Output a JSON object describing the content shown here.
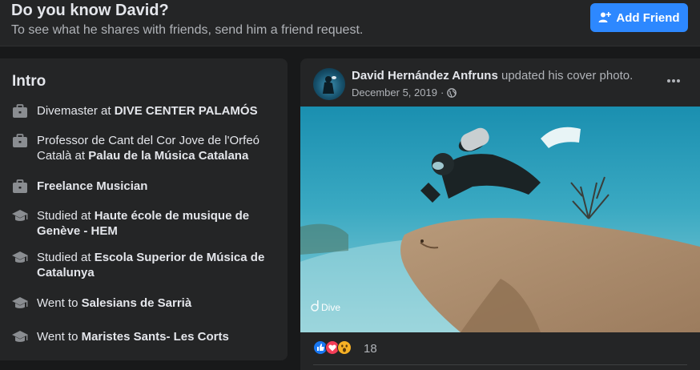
{
  "header": {
    "title": "Do you know David?",
    "subtitle": "To see what he shares with friends, send him a friend request.",
    "add_friend_label": "Add Friend"
  },
  "intro": {
    "heading": "Intro",
    "items": [
      {
        "icon": "briefcase-icon",
        "prefix": "Divemaster at ",
        "bold": "DIVE CENTER PALAMÓS"
      },
      {
        "icon": "briefcase-icon",
        "prefix": "Professor de Cant del Cor Jove de l'Orfeó Català at ",
        "bold": "Palau de la Música Catalana"
      },
      {
        "icon": "briefcase-icon",
        "prefix": "",
        "bold": "Freelance Musician"
      },
      {
        "icon": "graduation-cap-icon",
        "prefix": "Studied at ",
        "bold": "Haute école de musique de Genève - HEM"
      },
      {
        "icon": "graduation-cap-icon",
        "prefix": "Studied at ",
        "bold": "Escola Superior de Música de Catalunya"
      },
      {
        "icon": "graduation-cap-icon",
        "prefix": "Went to ",
        "bold": "Salesians de Sarrià"
      },
      {
        "icon": "graduation-cap-icon",
        "prefix": "Went to ",
        "bold": "Maristes Sants- Les Corts"
      }
    ]
  },
  "post": {
    "author": "David Hernández Anfruns",
    "action": " updated his cover photo.",
    "date": "December 5, 2019",
    "separator": " · ",
    "photo_watermark": "Dive",
    "reaction_count": "18",
    "reactions": [
      "like-icon",
      "love-icon",
      "wow-icon"
    ]
  },
  "colors": {
    "background": "#18191a",
    "card": "#242526",
    "accent": "#2d88ff",
    "text": "#e4e6eb",
    "secondary_text": "#b0b3b8"
  }
}
